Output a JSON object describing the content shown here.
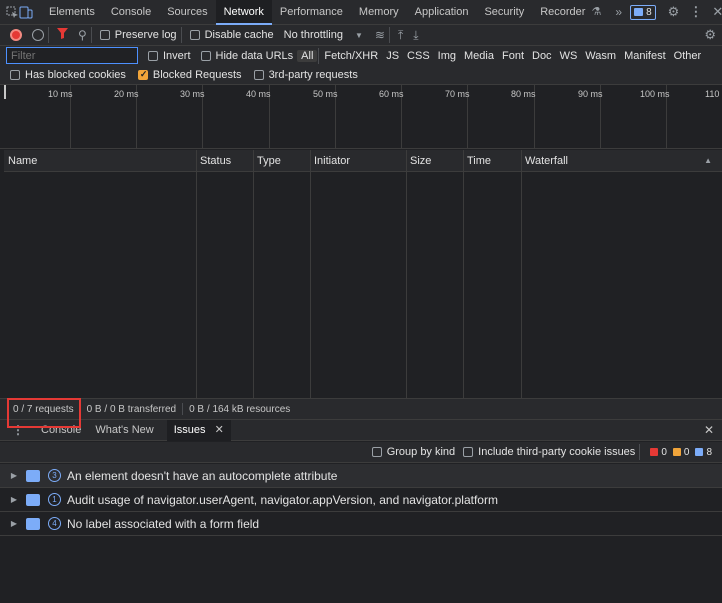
{
  "tabs": [
    {
      "label": "Elements"
    },
    {
      "label": "Console"
    },
    {
      "label": "Sources"
    },
    {
      "label": "Network"
    },
    {
      "label": "Performance"
    },
    {
      "label": "Memory"
    },
    {
      "label": "Application"
    },
    {
      "label": "Security"
    },
    {
      "label": "Recorder"
    }
  ],
  "issues_badge_count": "8",
  "toolbar": {
    "preserve_log": "Preserve log",
    "disable_cache": "Disable cache",
    "throttling": "No throttling"
  },
  "filter": {
    "placeholder": "Filter",
    "invert": "Invert",
    "hide_data_urls": "Hide data URLs",
    "types": [
      "All",
      "Fetch/XHR",
      "JS",
      "CSS",
      "Img",
      "Media",
      "Font",
      "Doc",
      "WS",
      "Wasm",
      "Manifest",
      "Other"
    ]
  },
  "blocked": {
    "has_blocked_cookies": "Has blocked cookies",
    "blocked_requests": "Blocked Requests",
    "third_party": "3rd-party requests"
  },
  "timeline_ticks": [
    "10 ms",
    "20 ms",
    "30 ms",
    "40 ms",
    "50 ms",
    "60 ms",
    "70 ms",
    "80 ms",
    "90 ms",
    "100 ms",
    "110"
  ],
  "columns": [
    "Name",
    "Status",
    "Type",
    "Initiator",
    "Size",
    "Time",
    "Waterfall"
  ],
  "status": {
    "requests": "0 / 7 requests",
    "transferred": "0 B / 0 B transferred",
    "resources": "0 B / 164 kB resources"
  },
  "drawer_tabs": [
    {
      "label": "Console"
    },
    {
      "label": "What's New"
    },
    {
      "label": "Issues"
    }
  ],
  "issues_toolbar": {
    "group_by_kind": "Group by kind",
    "include_third_party": "Include third-party cookie issues",
    "counts": {
      "errors": "0",
      "warnings": "0",
      "info": "8"
    }
  },
  "issues": [
    {
      "count": "3",
      "text": "An element doesn't have an autocomplete attribute"
    },
    {
      "count": "1",
      "text": "Audit usage of navigator.userAgent, navigator.appVersion, and navigator.platform"
    },
    {
      "count": "4",
      "text": "No label associated with a form field"
    }
  ],
  "colors": {
    "accent": "#7cacf8",
    "record": "#e53935",
    "warning": "#f0a43a",
    "highlight": "#e53935"
  }
}
